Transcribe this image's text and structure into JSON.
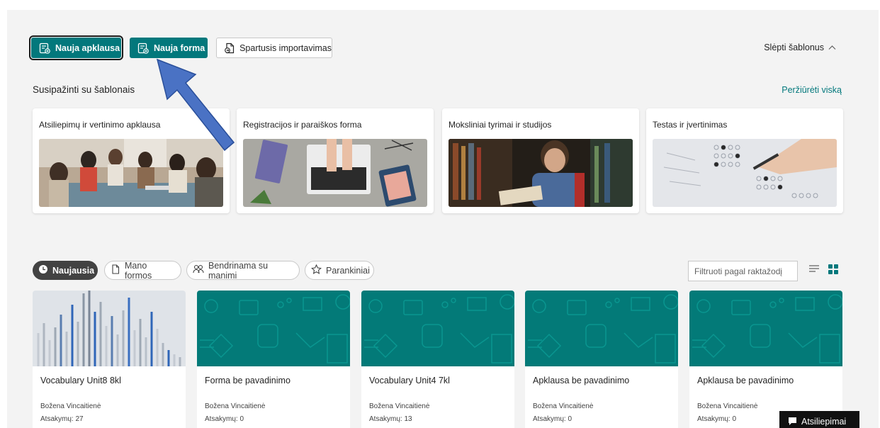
{
  "toolbar": {
    "new_survey_label": "Nauja apklausa",
    "new_form_label": "Nauja forma",
    "quick_import_label": "Spartusis importavimas",
    "hide_templates_label": "Slėpti šablonus"
  },
  "templates": {
    "section_title": "Susipažinti su šablonais",
    "view_all_label": "Peržiūrėti viską",
    "cards": [
      {
        "title": "Atsiliepimų ir vertinimo apklausa"
      },
      {
        "title": "Registracijos ir paraiškos forma"
      },
      {
        "title": "Moksliniai tyrimai ir studijos"
      },
      {
        "title": "Testas ir įvertinimas"
      }
    ]
  },
  "filters": {
    "tabs": [
      {
        "label": "Naujausia"
      },
      {
        "label": "Mano formos"
      },
      {
        "label": "Bendrinama su manimi"
      },
      {
        "label": "Parankiniai"
      }
    ],
    "search_placeholder": "Filtruoti pagal raktažodį"
  },
  "forms": [
    {
      "title": "Vocabulary Unit8 8kl",
      "author": "Božena Vincaitienė",
      "responses": "Atsakymų: 27"
    },
    {
      "title": "Forma be pavadinimo",
      "author": "Božena Vincaitienė",
      "responses": "Atsakymų: 0"
    },
    {
      "title": "Vocabulary Unit4 7kl",
      "author": "Božena Vincaitienė",
      "responses": "Atsakymų: 13"
    },
    {
      "title": "Apklausa be pavadinimo",
      "author": "Božena Vincaitienė",
      "responses": "Atsakymų: 0"
    },
    {
      "title": "Apklausa be pavadinimo",
      "author": "Božena Vincaitienė",
      "responses": "Atsakymų: 0"
    }
  ],
  "feedback": {
    "label": "Atsiliepimai"
  },
  "colors": {
    "accent": "#03787c",
    "link": "#03787c",
    "arrow": "#4a72c4"
  }
}
